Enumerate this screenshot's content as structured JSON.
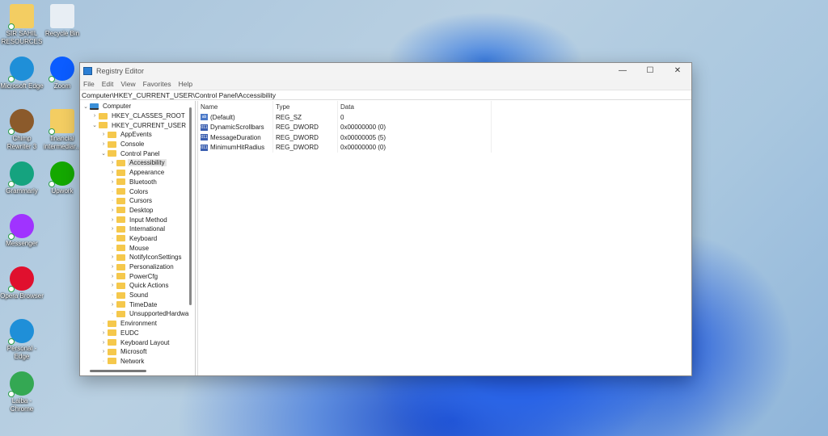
{
  "desktop": [
    {
      "label": "SIR SAHIL RESOURCES",
      "icon": "folder-icon",
      "color": "#f3cd62"
    },
    {
      "label": "Recycle Bin",
      "icon": "recycle-bin-icon",
      "color": "#e8eef4"
    },
    {
      "label": "Microsoft Edge",
      "icon": "edge-icon",
      "color": "#1f8fd8"
    },
    {
      "label": "Zoom",
      "icon": "zoom-icon",
      "color": "#0b5cff"
    },
    {
      "label": "Chimp Rewriter 3",
      "icon": "chimp-icon",
      "color": "#8b5a2b"
    },
    {
      "label": "financial intermediar...",
      "icon": "folder-icon",
      "color": "#f3cd62"
    },
    {
      "label": "Grammarly",
      "icon": "grammarly-icon",
      "color": "#15a37f"
    },
    {
      "label": "Upwork",
      "icon": "upwork-icon",
      "color": "#14a800"
    },
    {
      "label": "Messenger",
      "icon": "messenger-icon",
      "color": "#a033ff"
    },
    {
      "label": "Opera Browser",
      "icon": "opera-icon",
      "color": "#e0102e"
    },
    {
      "label": "Personal - Edge",
      "icon": "edge-icon",
      "color": "#1f8fd8"
    },
    {
      "label": "Laiba - Chrome",
      "icon": "chrome-icon",
      "color": "#34a853"
    }
  ],
  "window": {
    "title": "Registry Editor",
    "controls": [
      "—",
      "☐",
      "✕"
    ],
    "menu": [
      "File",
      "Edit",
      "View",
      "Favorites",
      "Help"
    ],
    "address": "Computer\\HKEY_CURRENT_USER\\Control Panel\\Accessibility"
  },
  "tree": [
    {
      "label": "Computer",
      "level": 0,
      "exp": "open",
      "pc": true
    },
    {
      "label": "HKEY_CLASSES_ROOT",
      "level": 1,
      "exp": "closed"
    },
    {
      "label": "HKEY_CURRENT_USER",
      "level": 1,
      "exp": "open"
    },
    {
      "label": "AppEvents",
      "level": 2,
      "exp": "closed"
    },
    {
      "label": "Console",
      "level": 2,
      "exp": "closed"
    },
    {
      "label": "Control Panel",
      "level": 2,
      "exp": "open"
    },
    {
      "label": "Accessibility",
      "level": 3,
      "exp": "closed",
      "selected": true
    },
    {
      "label": "Appearance",
      "level": 3,
      "exp": "closed"
    },
    {
      "label": "Bluetooth",
      "level": 3,
      "exp": "closed"
    },
    {
      "label": "Colors",
      "level": 3,
      "exp": "none"
    },
    {
      "label": "Cursors",
      "level": 3,
      "exp": "none"
    },
    {
      "label": "Desktop",
      "level": 3,
      "exp": "closed"
    },
    {
      "label": "Input Method",
      "level": 3,
      "exp": "closed"
    },
    {
      "label": "International",
      "level": 3,
      "exp": "closed"
    },
    {
      "label": "Keyboard",
      "level": 3,
      "exp": "none"
    },
    {
      "label": "Mouse",
      "level": 3,
      "exp": "none"
    },
    {
      "label": "NotifyIconSettings",
      "level": 3,
      "exp": "closed"
    },
    {
      "label": "Personalization",
      "level": 3,
      "exp": "closed"
    },
    {
      "label": "PowerCfg",
      "level": 3,
      "exp": "closed"
    },
    {
      "label": "Quick Actions",
      "level": 3,
      "exp": "closed"
    },
    {
      "label": "Sound",
      "level": 3,
      "exp": "none"
    },
    {
      "label": "TimeDate",
      "level": 3,
      "exp": "closed"
    },
    {
      "label": "UnsupportedHardwa",
      "level": 3,
      "exp": "none"
    },
    {
      "label": "Environment",
      "level": 2,
      "exp": "none"
    },
    {
      "label": "EUDC",
      "level": 2,
      "exp": "closed"
    },
    {
      "label": "Keyboard Layout",
      "level": 2,
      "exp": "closed"
    },
    {
      "label": "Microsoft",
      "level": 2,
      "exp": "closed"
    },
    {
      "label": "Network",
      "level": 2,
      "exp": "none"
    }
  ],
  "columns": {
    "name": "Name",
    "type": "Type",
    "data": "Data"
  },
  "values": [
    {
      "name": "(Default)",
      "type": "REG_SZ",
      "data": "0",
      "kind": "string"
    },
    {
      "name": "DynamicScrollbars",
      "type": "REG_DWORD",
      "data": "0x00000000 (0)",
      "kind": "binary"
    },
    {
      "name": "MessageDuration",
      "type": "REG_DWORD",
      "data": "0x00000005 (5)",
      "kind": "binary"
    },
    {
      "name": "MinimumHitRadius",
      "type": "REG_DWORD",
      "data": "0x00000000 (0)",
      "kind": "binary"
    }
  ]
}
